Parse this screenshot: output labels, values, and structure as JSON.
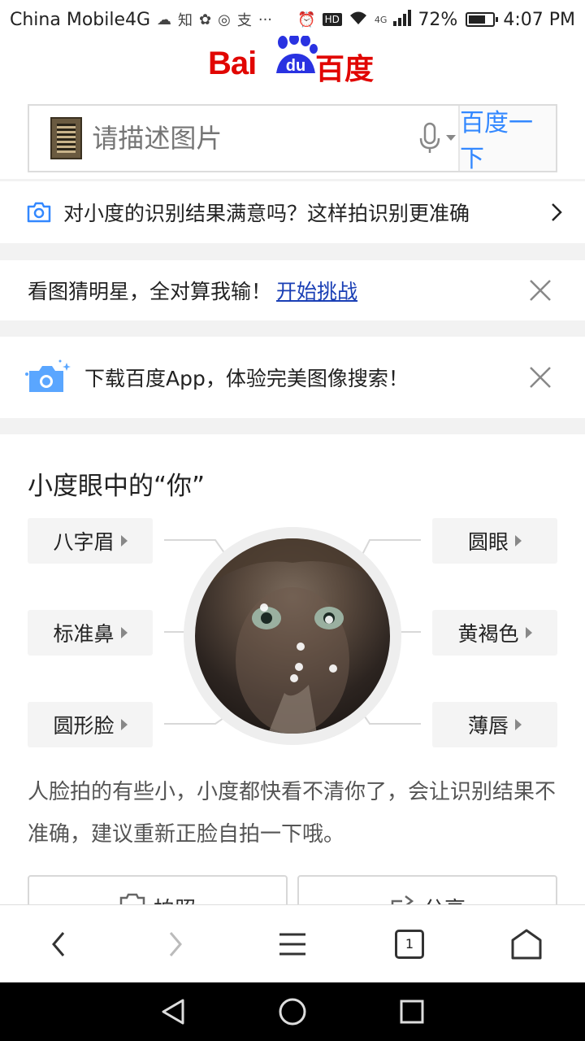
{
  "status_bar": {
    "carrier": "China Mobile4G",
    "app_icons": [
      "weather-icon",
      "zhihu-icon",
      "huawei-icon",
      "wechat-icon",
      "alipay-icon"
    ],
    "zhi_char": "知",
    "zhi_pay_char": "支",
    "more": "···",
    "network": "4G",
    "battery": "72%",
    "battery_level": 0.72,
    "time": "4:07 PM"
  },
  "header": {
    "logo_bai": "Bai",
    "logo_du": "du",
    "logo_cn": "百度",
    "search_placeholder": "请描述图片",
    "search_button": "百度一下"
  },
  "feedback_bar": {
    "text": "对小度的识别结果满意吗？这样拍识别更准确"
  },
  "guess_star": {
    "text": "看图猜明星，全对算我输！",
    "link": "开始挑战"
  },
  "download_app": {
    "text": "下载百度App，体验完美图像搜索！"
  },
  "face_card": {
    "title": "小度眼中的“你”",
    "tags_left": [
      "八字眉",
      "标准鼻",
      "圆形脸"
    ],
    "tags_right": [
      "圆眼",
      "黄褐色",
      "薄唇"
    ],
    "description": "人脸拍的有些小，小度都快看不清你了，会让识别结果不准确，建议重新正脸自拍一下哦。",
    "btn_photo": "拍照",
    "btn_share": "分享"
  },
  "browser_nav": {
    "tab_count": "1"
  },
  "colors": {
    "brand_red": "#e10602",
    "brand_blue": "#2932e1",
    "link_blue": "#3388ff"
  }
}
